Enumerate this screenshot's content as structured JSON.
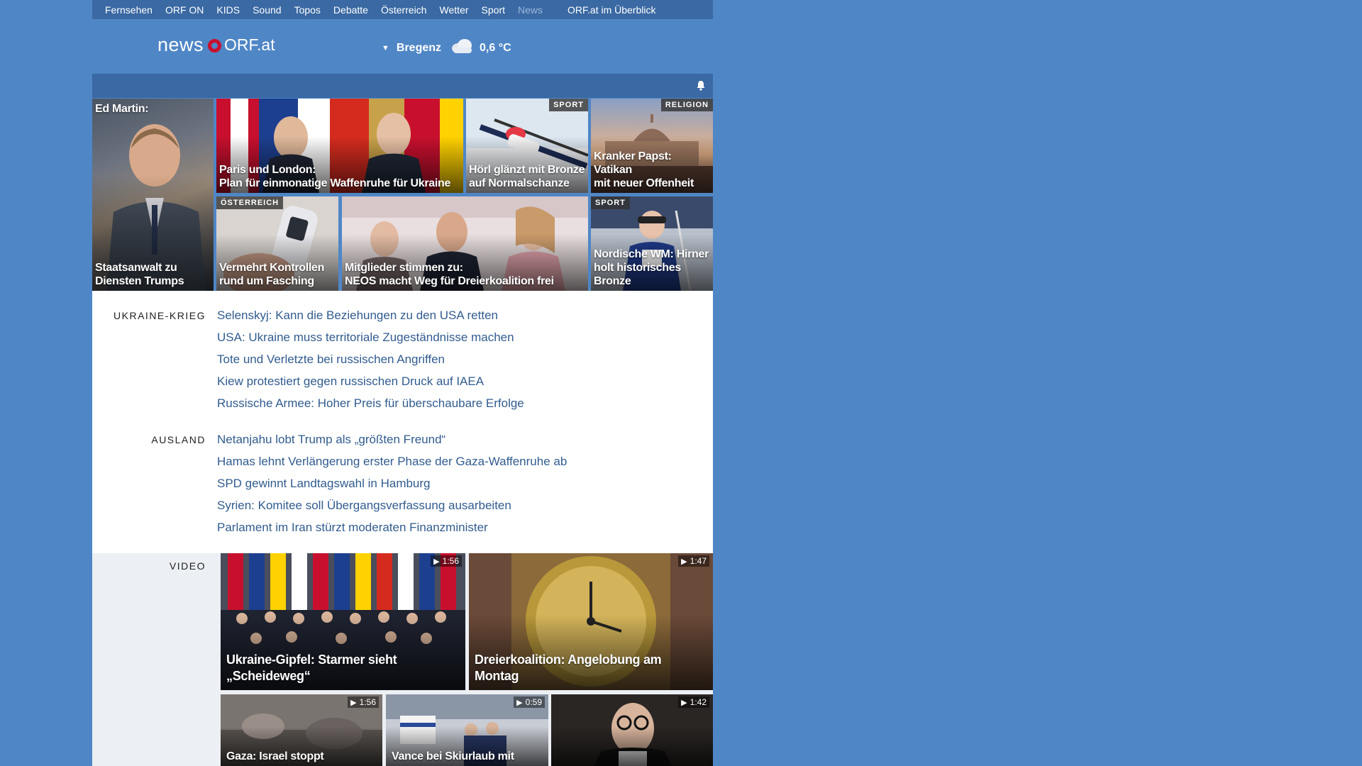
{
  "topnav": {
    "items": [
      "Fernsehen",
      "ORF ON",
      "KIDS",
      "Sound",
      "Topos",
      "Debatte",
      "Österreich",
      "Wetter",
      "Sport",
      "News"
    ],
    "overview": "ORF.at im Überblick"
  },
  "logo": {
    "news": "news",
    "orf": "ORF.at"
  },
  "weather": {
    "location": "Bregenz",
    "temperature": "0,6 °C"
  },
  "tiles": [
    {
      "caption": "Ed Martin:",
      "caption2": "Staatsanwalt zu\nDiensten Trumps",
      "badge": ""
    },
    {
      "caption": "Paris und London:\nPlan für einmonatige Waffenruhe für Ukraine",
      "badge": ""
    },
    {
      "caption": "Hörl glänzt mit Bronze\nauf Normalschanze",
      "badge": "SPORT"
    },
    {
      "caption": "Kranker Papst: Vatikan\nmit neuer Offenheit",
      "badge": "RELIGION"
    },
    {
      "caption": "Vermehrt Kontrollen\nrund um Fasching",
      "badge": "ÖSTERREICH"
    },
    {
      "caption": "Mitglieder stimmen zu:\nNEOS macht Weg für Dreierkoalition frei",
      "badge": ""
    },
    {
      "caption": "Nordische WM: Hirner\nholt historisches Bronze",
      "badge": "SPORT"
    }
  ],
  "sections": [
    {
      "label": "UKRAINE-KRIEG",
      "links": [
        "Selenskyj: Kann die Beziehungen zu den USA retten",
        "USA: Ukraine muss territoriale Zugeständnisse machen",
        "Tote und Verletzte bei russischen Angriffen",
        "Kiew protestiert gegen russischen Druck auf IAEA",
        "Russische Armee: Hoher Preis für überschaubare Erfolge"
      ]
    },
    {
      "label": "AUSLAND",
      "links": [
        "Netanjahu lobt Trump als „größten Freund“",
        "Hamas lehnt Verlängerung erster Phase der Gaza-Waffenruhe ab",
        "SPD gewinnt Landtagswahl in Hamburg",
        "Syrien: Komitee soll Übergangsverfassung ausarbeiten",
        "Parlament im Iran stürzt moderaten Finanzminister"
      ]
    }
  ],
  "video": {
    "label": "VIDEO",
    "items": [
      {
        "caption": "Ukraine-Gipfel: Starmer sieht\n„Scheideweg“",
        "duration": "1:56"
      },
      {
        "caption": "Dreierkoalition: Angelobung am Montag",
        "duration": "1:47"
      },
      {
        "caption": "Gaza: Israel stoppt",
        "duration": "1:56"
      },
      {
        "caption": "Vance bei Skiurlaub mit",
        "duration": "0:59"
      },
      {
        "caption": "",
        "duration": "1:42"
      }
    ]
  },
  "icons": {
    "bell": "bell-icon",
    "cloud": "cloud-icon",
    "play": "play-icon"
  },
  "colors": {
    "background": "#4f86c6",
    "nav": "#3a69a3",
    "link": "#315c8f",
    "logo_ring": "#c8102e"
  }
}
